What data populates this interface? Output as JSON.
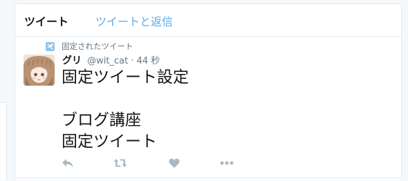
{
  "tabs": [
    {
      "label": "ツイート",
      "active": true
    },
    {
      "label": "ツイートと返信",
      "active": false
    }
  ],
  "tweet": {
    "pinned_label": "固定されたツイート",
    "display_name": "グリ",
    "handle": "@wit_cat",
    "time": "· 44 秒",
    "lines": [
      "固定ツイート設定",
      "",
      "ブログ講座",
      "固定ツイート"
    ]
  },
  "actions": {
    "reply_icon": "reply-icon",
    "retweet_icon": "retweet-icon",
    "like_icon": "heart-icon",
    "more_icon": "more-icon"
  },
  "colors": {
    "accent": "#55acee",
    "text": "#14171a",
    "muted": "#657786",
    "action_icon": "#aab8c2",
    "border": "#e1e8ed"
  }
}
